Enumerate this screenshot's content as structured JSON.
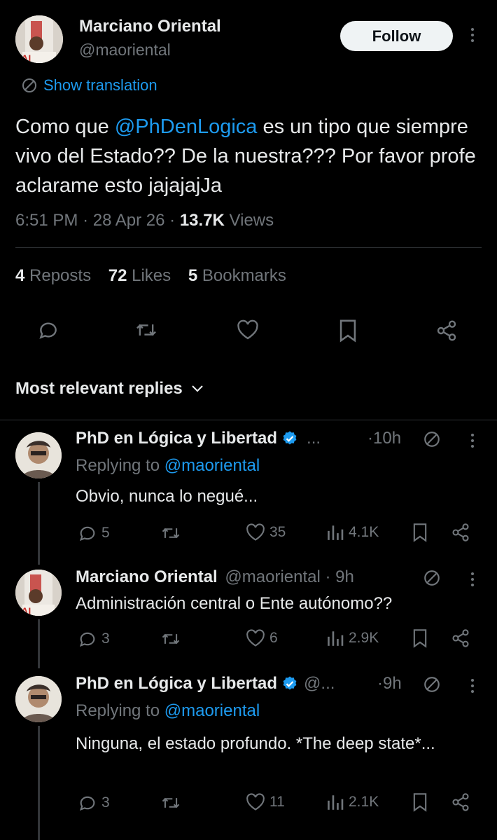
{
  "main_tweet": {
    "author_name": "Marciano Oriental",
    "author_handle": "@maoriental",
    "follow_label": "Follow",
    "show_translation": "Show translation",
    "text_before": "Como que ",
    "mention": "@PhDenLogica",
    "text_after": " es un tipo que siempre vivo del Estado?? De la nuestra??? Por favor profe aclarame esto jajajajJa",
    "time": "6:51 PM",
    "date": "28 Apr 26",
    "views_count": "13.7K",
    "views_label": "Views",
    "reposts_count": "4",
    "reposts_label": "Reposts",
    "likes_count": "72",
    "likes_label": "Likes",
    "bookmarks_count": "5",
    "bookmarks_label": "Bookmarks"
  },
  "sort_label": "Most relevant replies",
  "replies": [
    {
      "author_name": "PhD en Lógica y Libertad",
      "handle_trunc": "...",
      "time": "10h",
      "replying_to_prefix": "Replying to ",
      "replying_to": "@maoriental",
      "text": "Obvio, nunca lo negué...",
      "replies": "5",
      "reposts": "",
      "likes": "35",
      "views": "4.1K"
    },
    {
      "author_name": "Marciano Oriental",
      "handle": "@maoriental",
      "time": "9h",
      "text": "Administración central o Ente autónomo??",
      "replies": "3",
      "reposts": "",
      "likes": "6",
      "views": "2.9K"
    },
    {
      "author_name": "PhD en Lógica y Libertad",
      "handle_trunc": "@...",
      "time": "9h",
      "replying_to_prefix": "Replying to ",
      "replying_to": "@maoriental",
      "text": "Ninguna, el estado profundo. *The deep state*...",
      "replies": "3",
      "reposts": "",
      "likes": "11",
      "views": "2.1K"
    }
  ],
  "icons": [
    "translate-icon",
    "more-icon",
    "reply-icon",
    "repost-icon",
    "like-icon",
    "bookmark-icon",
    "share-icon",
    "views-icon",
    "verified-icon",
    "chevron-down-icon"
  ],
  "colors": {
    "background": "#000000",
    "text": "#e7e9ea",
    "muted": "#71767b",
    "link": "#1d9bf0",
    "divider": "#2f3336",
    "follow_bg": "#eff3f4"
  }
}
